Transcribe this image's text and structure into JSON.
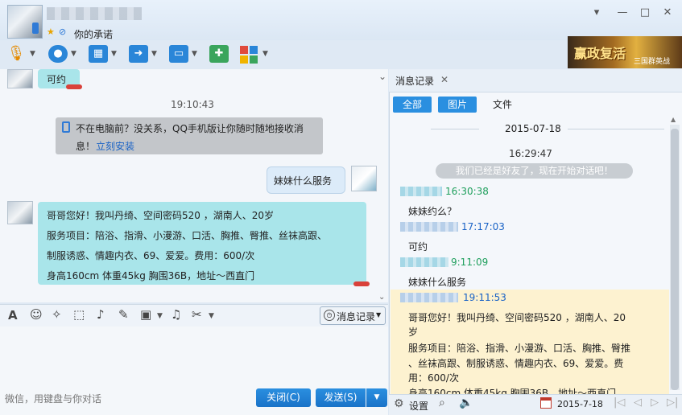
{
  "header": {
    "signature": "你的承诺",
    "window_controls": {
      "menu": "▾",
      "minimize": "—",
      "maximize": "□",
      "close": "✕"
    }
  },
  "ad": {
    "title": "赢政复活",
    "subtitle": "三国群英战"
  },
  "chat": {
    "msg0_text": "可约",
    "time1": "19:10:43",
    "system_text_1": "不在电脑前？没关系，QQ手机版让你随时随地接收消",
    "system_text_2": "息！",
    "system_link": "立刻安装",
    "my_message": "妹妹什么服务",
    "her_lines": [
      "哥哥您好！我叫丹绮、空间密码520 ，湖南人、20岁",
      "服务项目：陪浴、指滑、小漫游、口活、胸推、臀推、丝袜高跟、",
      "制服诱惑、情趣内衣、69、爱爱。费用：600/次",
      "身高160cm   体重45kg  胸围36B，地址～西直门"
    ]
  },
  "input": {
    "history_button": "消息记录",
    "placeholder": "微信，用键盘与你对话",
    "close_button": "关闭(C)",
    "send_button": "发送(S)"
  },
  "history": {
    "tab_label": "消息记录",
    "filters": [
      "全部",
      "图片",
      "文件"
    ],
    "date": "2015-07-18",
    "time0": "16:29:47",
    "notice": "我们已经是好友了，现在开始对话吧！",
    "entries": [
      {
        "time": "16:30:38",
        "text": "妹妹约么？"
      },
      {
        "time": "17:17:03",
        "text": "可约"
      },
      {
        "time": "9:11:09",
        "text": "妹妹什么服务"
      },
      {
        "time": "19:11:53",
        "text": ""
      }
    ],
    "long_lines": [
      "哥哥您好！我叫丹绮、空间密码520 ，湖南人、20",
      "岁",
      "服务项目：陪浴、指滑、小漫游、口活、胸推、臀推",
      "、丝袜高跟、制服诱惑、情趣内衣、69、爱爱。费",
      "用：600/次",
      "身高160cm   体重45kg  胸围36B，地址～西直门"
    ],
    "settings_label": "设置",
    "footer_date": "2015-7-18"
  },
  "icons": [
    "microphone-icon",
    "webcam-icon",
    "screen-share-icon",
    "file-transfer-icon",
    "remote-desktop-icon",
    "new-message-icon",
    "apps-grid-icon",
    "font-icon",
    "emoji-icon",
    "poke-icon",
    "screenshot-icon",
    "voice-icon",
    "edit-icon",
    "image-icon",
    "music-icon",
    "scissors-icon"
  ],
  "colors": {
    "accent": "#1a73c8",
    "green_bubble": "#a9e5ea",
    "highlight": "#fdf2d0"
  }
}
